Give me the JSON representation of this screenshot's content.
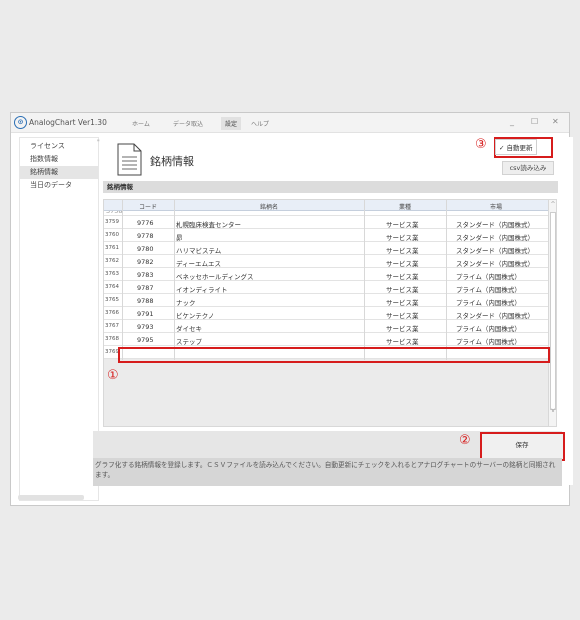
{
  "app": {
    "title": "AnalogChart Ver1.30"
  },
  "menu": [
    {
      "label": "ホーム",
      "active": false
    },
    {
      "label": "データ取込",
      "active": false
    },
    {
      "label": "設定",
      "active": true
    },
    {
      "label": "ヘルプ",
      "active": false
    }
  ],
  "window_controls": {
    "minimize": "_",
    "maximize": "☐",
    "close": "✕"
  },
  "sidebar": {
    "items": [
      {
        "label": "ライセンス",
        "active": false
      },
      {
        "label": "指数情報",
        "active": false
      },
      {
        "label": "銘柄情報",
        "active": true
      },
      {
        "label": "当日のデータ",
        "active": false
      }
    ],
    "grip": "\""
  },
  "page": {
    "title": "銘柄情報",
    "section": "銘柄情報"
  },
  "auto_update": {
    "label": "自動更新",
    "checked": true,
    "check_mark": "✓"
  },
  "csv_button": {
    "label": "csv読み込み"
  },
  "annotations": {
    "n1": "①",
    "n2": "②",
    "n3": "③"
  },
  "table": {
    "columns": [
      "コード",
      "銘柄名",
      "業種",
      "市場"
    ],
    "rows": [
      {
        "idx": "3759",
        "code": "9776",
        "name": "札幌臨床検査センター",
        "industry": "サービス業",
        "market": "スタンダード（内国株式）"
      },
      {
        "idx": "3760",
        "code": "9778",
        "name": "昴",
        "industry": "サービス業",
        "market": "スタンダード（内国株式）"
      },
      {
        "idx": "3761",
        "code": "9780",
        "name": "ハリマビステム",
        "industry": "サービス業",
        "market": "スタンダード（内国株式）"
      },
      {
        "idx": "3762",
        "code": "9782",
        "name": "ディーエムエス",
        "industry": "サービス業",
        "market": "スタンダード（内国株式）"
      },
      {
        "idx": "3763",
        "code": "9783",
        "name": "ベネッセホールディングス",
        "industry": "サービス業",
        "market": "プライム（内国株式）"
      },
      {
        "idx": "3764",
        "code": "9787",
        "name": "イオンディライト",
        "industry": "サービス業",
        "market": "プライム（内国株式）"
      },
      {
        "idx": "3765",
        "code": "9788",
        "name": "ナック",
        "industry": "サービス業",
        "market": "プライム（内国株式）"
      },
      {
        "idx": "3766",
        "code": "9791",
        "name": "ビケンテクノ",
        "industry": "サービス業",
        "market": "スタンダード（内国株式）"
      },
      {
        "idx": "3767",
        "code": "9793",
        "name": "ダイセキ",
        "industry": "サービス業",
        "market": "プライム（内国株式）"
      },
      {
        "idx": "3768",
        "code": "9795",
        "name": "ステップ",
        "industry": "サービス業",
        "market": "プライム（内国株式）"
      },
      {
        "idx": "3769",
        "code": "",
        "name": "",
        "industry": "",
        "market": ""
      }
    ]
  },
  "save_button": {
    "label": "保存"
  },
  "message": "グラフ化する銘柄情報を登録します。ＣＳＶファイルを読み込んでください。自動更新にチェックを入れるとアナログチャートのサーバーの銘柄と同期されます。",
  "colors": {
    "annotation": "#d61c1c",
    "logo": "#2b6fb5",
    "header_bg": "#e8eef7"
  }
}
